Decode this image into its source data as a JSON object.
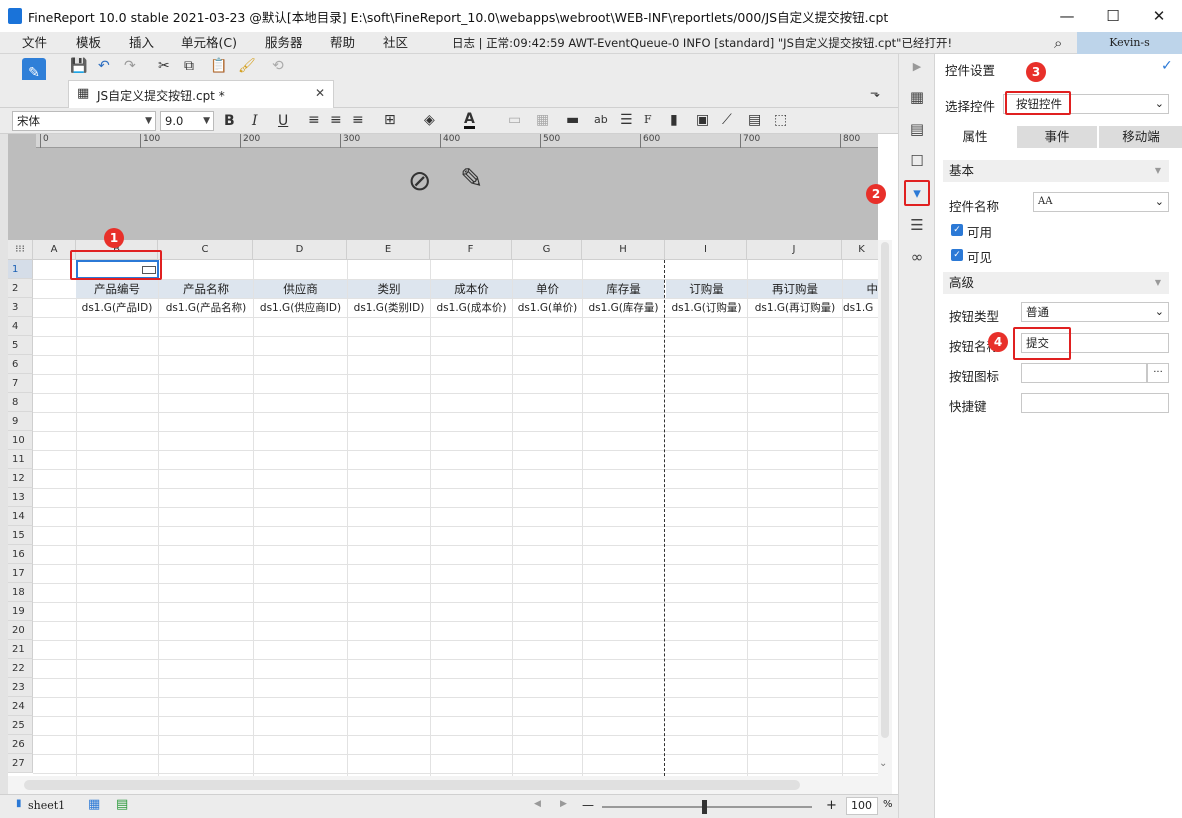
{
  "window": {
    "title": "FineReport 10.0 stable 2021-03-23 @默认[本地目录]    E:\\soft\\FineReport_10.0\\webapps\\webroot\\WEB-INF\\reportlets/000/JS自定义提交按钮.cpt",
    "minimize": "—",
    "maximize": "☐",
    "close": "✕"
  },
  "menu": {
    "items": [
      "文件",
      "模板",
      "插入",
      "单元格(C)",
      "服务器",
      "帮助",
      "社区"
    ],
    "log": "日志 | 正常:09:42:59 AWT-EventQueue-0 INFO [standard] \"JS自定义提交按钮.cpt\"已经打开!",
    "user": "Kevin-s"
  },
  "tab": {
    "label": "JS自定义提交按钮.cpt *",
    "close": "✕"
  },
  "format": {
    "font": "宋体",
    "size": "9.0",
    "bold": "B",
    "italic": "I",
    "underline": "U"
  },
  "ruler": [
    "0",
    "100",
    "200",
    "300",
    "400",
    "500",
    "600",
    "700",
    "800"
  ],
  "grid": {
    "columns": [
      "A",
      "B",
      "C",
      "D",
      "E",
      "F",
      "G",
      "H",
      "I",
      "J",
      "K"
    ],
    "rows": [
      "1",
      "2",
      "3",
      "4",
      "5",
      "6",
      "7",
      "8",
      "9",
      "10",
      "11",
      "12",
      "13",
      "14",
      "15",
      "16",
      "17",
      "18",
      "19",
      "20",
      "21",
      "22",
      "23",
      "24",
      "25",
      "26",
      "27"
    ],
    "header_row": [
      "产品编号",
      "产品名称",
      "供应商",
      "类别",
      "成本价",
      "单价",
      "库存量",
      "订购量",
      "再订购量",
      "中"
    ],
    "data_row": [
      "ds1.G(产品ID)",
      "ds1.G(产品名称)",
      "ds1.G(供应商ID)",
      "ds1.G(类别ID)",
      "ds1.G(成本价)",
      "ds1.G(单价)",
      "ds1.G(库存量)",
      "ds1.G(订购量)",
      "ds1.G(再订购量)",
      "ds1.G"
    ]
  },
  "status": {
    "sheet": "sheet1",
    "zoom": "100",
    "percent": "%",
    "minus": "—",
    "plus": "+"
  },
  "panel": {
    "title": "控件设置",
    "select_label": "选择控件",
    "select_value": "按钮控件",
    "tabs": [
      "属性",
      "事件",
      "移动端"
    ],
    "basic_section": "基本",
    "name_label": "控件名称",
    "name_value": "AA",
    "enabled_label": "可用",
    "visible_label": "可见",
    "advanced_section": "高级",
    "type_label": "按钮类型",
    "type_value": "普通",
    "btn_name_label": "按钮名称",
    "btn_name_value": "提交",
    "btn_icon_label": "按钮图标",
    "btn_icon_more": "···",
    "shortcut_label": "快捷键"
  },
  "annotations": [
    "1",
    "2",
    "3",
    "4"
  ],
  "colors": {
    "accent": "#2b79d6",
    "annotation_red": "#e02020"
  }
}
